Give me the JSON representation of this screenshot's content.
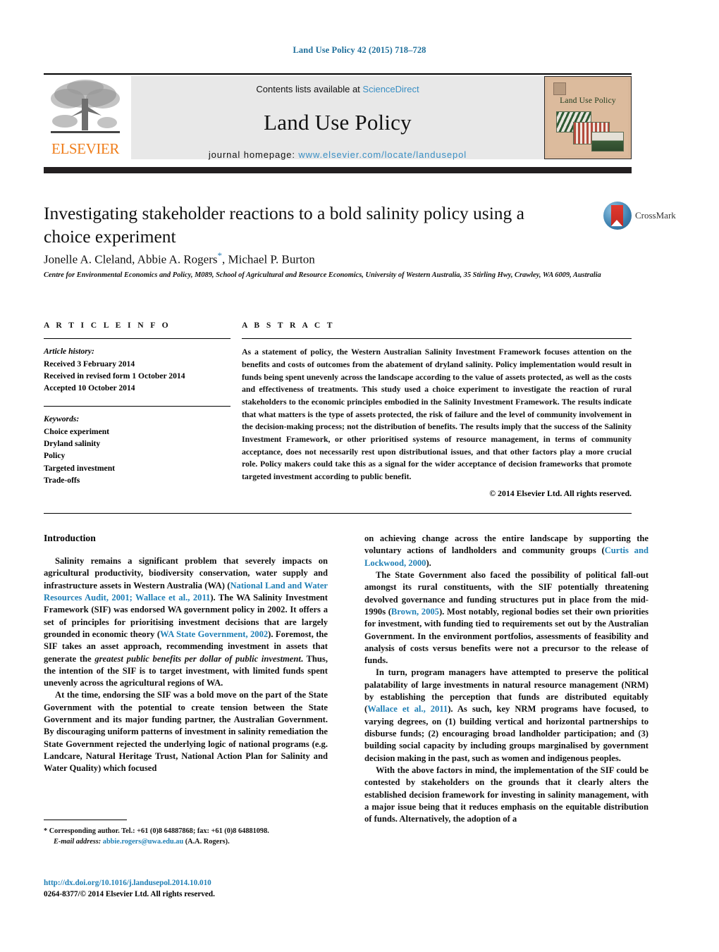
{
  "running_head": "Land Use Policy 42 (2015) 718–728",
  "journal_header": {
    "contents_prefix": "Contents lists available at ",
    "contents_link": "ScienceDirect",
    "journal_title": "Land Use Policy",
    "homepage_prefix": "journal homepage: ",
    "homepage_url": "www.elsevier.com/locate/landusepol",
    "publisher_logo_text": "ELSEVIER",
    "cover_title": "Land Use Policy"
  },
  "article": {
    "title": "Investigating stakeholder reactions to a bold salinity policy using a choice experiment",
    "authors": "Jonelle A. Cleland, Abbie A. Rogers",
    "authors_tail": ", Michael P. Burton",
    "corresponding_marker": "*",
    "affiliation": "Centre for Environmental Economics and Policy, M089, School of Agricultural and Resource Economics, University of Western Australia, 35 Stirling Hwy, Crawley, WA 6009, Australia",
    "crossmark_label": "CrossMark"
  },
  "article_info": {
    "heading": "A R T I C L E   I N F O",
    "history_label": "Article history:",
    "history": [
      "Received 3 February 2014",
      "Received in revised form 1 October 2014",
      "Accepted 10 October 2014"
    ],
    "keywords_label": "Keywords:",
    "keywords": [
      "Choice experiment",
      "Dryland salinity",
      "Policy",
      "Targeted investment",
      "Trade-offs"
    ]
  },
  "abstract": {
    "heading": "A B S T R A C T",
    "body": "As a statement of policy, the Western Australian Salinity Investment Framework focuses attention on the benefits and costs of outcomes from the abatement of dryland salinity. Policy implementation would result in funds being spent unevenly across the landscape according to the value of assets protected, as well as the costs and effectiveness of treatments. This study used a choice experiment to investigate the reaction of rural stakeholders to the economic principles embodied in the Salinity Investment Framework. The results indicate that what matters is the type of assets protected, the risk of failure and the level of community involvement in the decision-making process; not the distribution of benefits. The results imply that the success of the Salinity Investment Framework, or other prioritised systems of resource management, in terms of community acceptance, does not necessarily rest upon distributional issues, and that other factors play a more crucial role. Policy makers could take this as a signal for the wider acceptance of decision frameworks that promote targeted investment according to public benefit.",
    "copyright": "© 2014 Elsevier Ltd. All rights reserved."
  },
  "body": {
    "intro_heading": "Introduction",
    "left_column": {
      "p1_a": "Salinity remains a significant problem that severely impacts on agricultural productivity, biodiversity conservation, water supply and infrastructure assets in Western Australia (WA) (",
      "p1_ref1": "National Land and Water Resources Audit, 2001; Wallace et al., 2011",
      "p1_b": "). The WA Salinity Investment Framework (SIF) was endorsed WA government policy in 2002. It offers a set of principles for prioritising investment decisions that are largely grounded in economic theory (",
      "p1_ref2": "WA State Government, 2002",
      "p1_c": "). Foremost, the SIF takes an asset approach, recommending investment in assets that generate the ",
      "p1_ital": "greatest public benefits per dollar of public investment",
      "p1_d": ". Thus, the intention of the SIF is to target investment, with limited funds spent unevenly across the agricultural regions of WA.",
      "p2": "At the time, endorsing the SIF was a bold move on the part of the State Government with the potential to create tension between the State Government and its major funding partner, the Australian Government. By discouraging uniform patterns of investment in salinity remediation the State Government rejected the underlying logic of national programs (e.g. Landcare, Natural Heritage Trust, National Action Plan for Salinity and Water Quality) which focused"
    },
    "right_column": {
      "p1_a": "on achieving change across the entire landscape by supporting the voluntary actions of landholders and community groups (",
      "p1_ref": "Curtis and Lockwood, 2000",
      "p1_b": ").",
      "p2_a": "The State Government also faced the possibility of political fall-out amongst its rural constituents, with the SIF potentially threatening devolved governance and funding structures put in place from the mid-1990s (",
      "p2_ref": "Brown, 2005",
      "p2_b": "). Most notably, regional bodies set their own priorities for investment, with funding tied to requirements set out by the Australian Government. In the environment portfolios, assessments of feasibility and analysis of costs versus benefits were not a precursor to the release of funds.",
      "p3_a": "In turn, program managers have attempted to preserve the political palatability of large investments in natural resource management (NRM) by establishing the perception that funds are distributed equitably (",
      "p3_ref": "Wallace et al., 2011",
      "p3_b": "). As such, key NRM programs have focused, to varying degrees, on (1) building vertical and horizontal partnerships to disburse funds; (2) encouraging broad landholder participation; and (3) building social capacity by including groups marginalised by government decision making in the past, such as women and indigenous peoples.",
      "p4": "With the above factors in mind, the implementation of the SIF could be contested by stakeholders on the grounds that it clearly alters the established decision framework for investing in salinity management, with a major issue being that it reduces emphasis on the equitable distribution of funds. Alternatively, the adoption of a"
    }
  },
  "footnote": {
    "corresponding": "* Corresponding author. Tel.: +61 (0)8 64887868; fax: +61 (0)8 64881098.",
    "email_label": "E-mail address:",
    "email": "abbie.rogers@uwa.edu.au",
    "email_suffix": " (A.A. Rogers)."
  },
  "doi_block": {
    "doi_url": "http://dx.doi.org/10.1016/j.landusepol.2014.10.010",
    "issn_line": "0264-8377/© 2014 Elsevier Ltd. All rights reserved."
  },
  "colors": {
    "link_blue": "#1f7fb5",
    "elsevier_orange": "#ef7d1a",
    "banner_grey": "#e8e8e8",
    "cover_tan": "#dcbb9d"
  }
}
